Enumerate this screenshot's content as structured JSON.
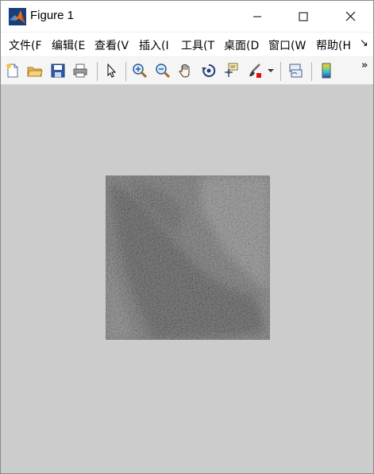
{
  "window": {
    "title": "Figure 1"
  },
  "menu": {
    "items": [
      "文件(F",
      "编辑(E",
      "查看(V",
      "插入(I",
      "工具(T",
      "桌面(D",
      "窗口(W",
      "帮助(H"
    ],
    "overflow": "↘"
  },
  "toolbar": {
    "overflow": "»",
    "icons": [
      "new-figure-icon",
      "open-file-icon",
      "save-icon",
      "print-icon",
      "pointer-icon",
      "zoom-in-icon",
      "zoom-out-icon",
      "pan-hand-icon",
      "rotate-3d-icon",
      "data-cursor-icon",
      "brush-icon",
      "brush-dropdown-icon",
      "link-plot-icon",
      "colorbar-icon"
    ]
  },
  "colors": {
    "figure_background": "#cccccc",
    "titlebar": "#ffffff",
    "toolbar": "#f5f5f5"
  }
}
